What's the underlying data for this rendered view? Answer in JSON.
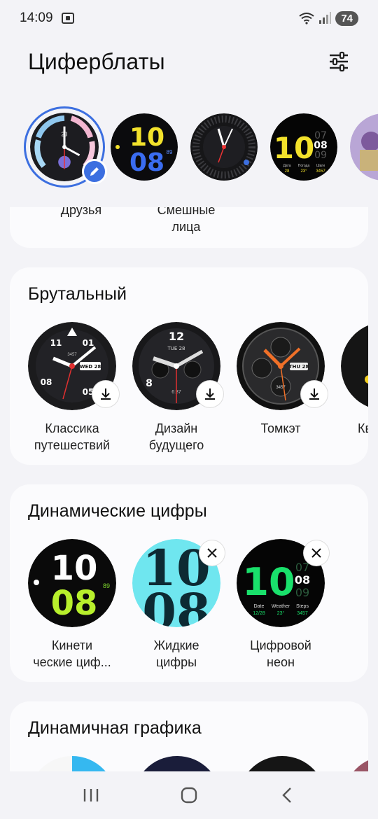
{
  "status": {
    "time": "14:09",
    "battery": "74"
  },
  "header": {
    "title": "Циферблаты",
    "filter_icon": "sliders-icon"
  },
  "current_faces": [
    {
      "name": "current-face-1",
      "selected": true,
      "edit_icon": "pencil-icon",
      "digits": "23"
    },
    {
      "name": "current-face-2",
      "line1": "10",
      "line2": "08",
      "small": "89"
    },
    {
      "name": "current-face-3"
    },
    {
      "name": "current-face-4",
      "line1": "10",
      "line2": "08",
      "sub1": "07",
      "sub2": "08",
      "sub3": "09",
      "labels": [
        "Дата",
        "Погода",
        "Шаги"
      ],
      "vals": [
        "28",
        "23°",
        "3457"
      ]
    },
    {
      "name": "current-face-5"
    }
  ],
  "friends_card": {
    "items": [
      "Друзья",
      "Смешные\nлица"
    ]
  },
  "brutal_card": {
    "title": "Брутальный",
    "items": [
      {
        "label": "Классика\nпутешествий",
        "nums": [
          "11",
          "01",
          "08",
          "05"
        ],
        "date": "WED 28",
        "small": "3457"
      },
      {
        "label": "Дизайн\nбудущего",
        "nums": [
          "12",
          "8"
        ],
        "date": "TUE 28",
        "small": "6:37"
      },
      {
        "label": "Томкэт",
        "date": "THU 28",
        "small": "3457"
      },
      {
        "label": "Ква"
      }
    ]
  },
  "digits_card": {
    "title": "Динамические цифры",
    "items": [
      {
        "label": "Кинети\nческие циф...",
        "line1": "10",
        "line2": "08",
        "small": "89"
      },
      {
        "label": "Жидкие\nцифры",
        "line1": "10",
        "line2": "08"
      },
      {
        "label": "Цифровой\nнеон",
        "line1": "10",
        "sub1": "07",
        "sub2": "08",
        "sub3": "09",
        "info_labels": [
          "Date",
          "Weather",
          "Steps"
        ],
        "info_vals": [
          "12/28",
          "23°",
          "3457"
        ]
      }
    ]
  },
  "graphics_card": {
    "title": "Динамичная графика"
  },
  "colors": {
    "accent": "#3c6fe0",
    "neon_green": "#19e06b",
    "yellow": "#f3e22b"
  }
}
